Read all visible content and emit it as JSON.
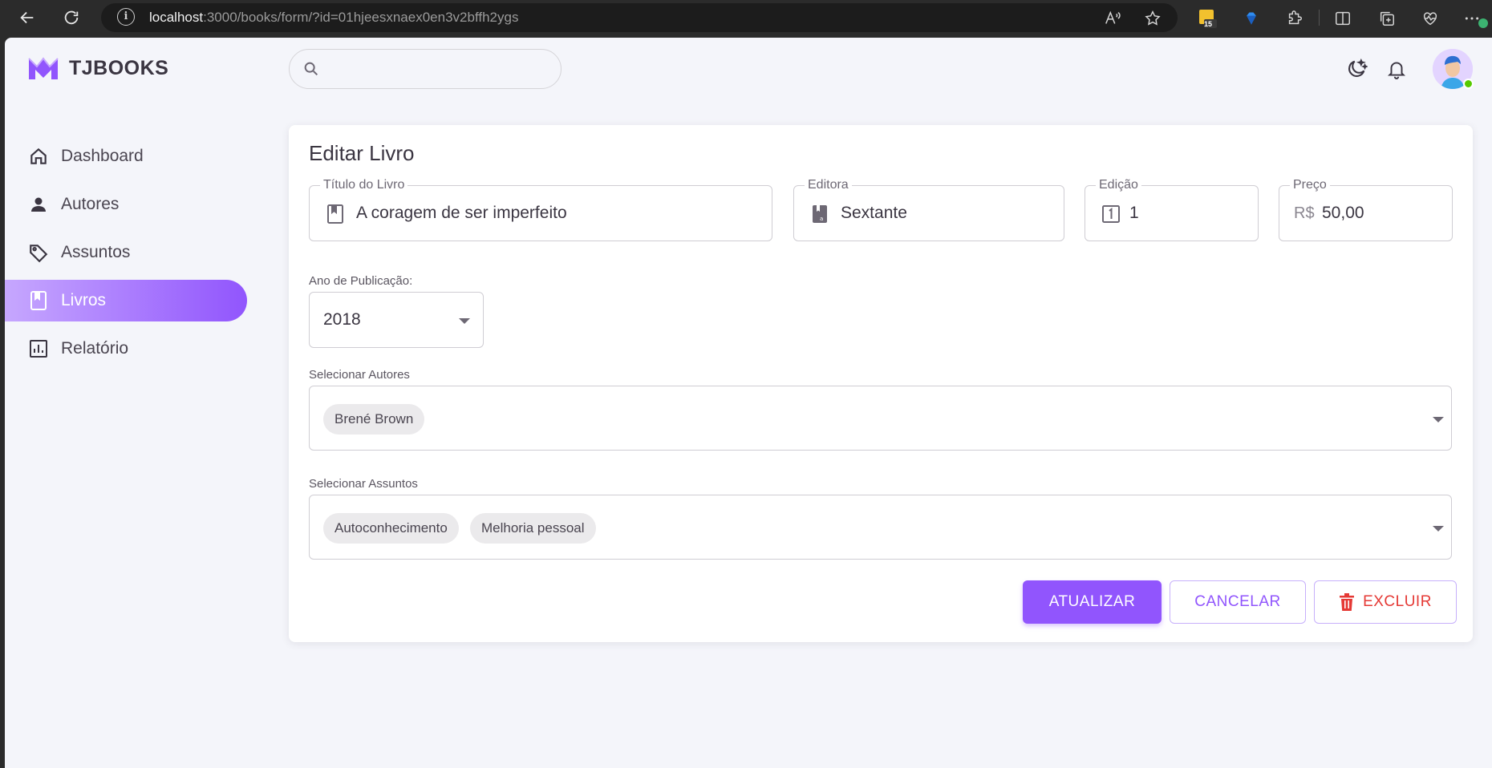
{
  "browser": {
    "url_host": "localhost",
    "url_rest": ":3000/books/form/?id=01hjeesxnaex0en3v2bffh2ygs",
    "extension_badge": "15"
  },
  "app": {
    "brand": "TJBOOKS",
    "search": {
      "placeholder": ""
    },
    "sidebar": {
      "items": [
        {
          "label": "Dashboard",
          "icon": "home-icon"
        },
        {
          "label": "Autores",
          "icon": "person-icon"
        },
        {
          "label": "Assuntos",
          "icon": "tag-icon"
        },
        {
          "label": "Livros",
          "icon": "book-icon",
          "active": true
        },
        {
          "label": "Relatório",
          "icon": "chart-icon"
        }
      ]
    },
    "colors": {
      "primary": "#9155fd",
      "danger": "#e53935",
      "background": "#f4f5fa"
    }
  },
  "form": {
    "title": "Editar Livro",
    "titulo": {
      "label": "Título do Livro",
      "value": "A coragem de ser imperfeito"
    },
    "editora": {
      "label": "Editora",
      "value": "Sextante"
    },
    "edicao": {
      "label": "Edição",
      "value": "1"
    },
    "preco": {
      "label": "Preço",
      "prefix": "R$",
      "value": "50,00"
    },
    "ano": {
      "label": "Ano de Publicação:",
      "value": "2018"
    },
    "autores": {
      "label": "Selecionar Autores",
      "chips": [
        "Brené Brown"
      ]
    },
    "assuntos": {
      "label": "Selecionar Assuntos",
      "chips": [
        "Autoconhecimento",
        "Melhoria pessoal"
      ]
    },
    "buttons": {
      "update": "ATUALIZAR",
      "cancel": "CANCELAR",
      "delete": "EXCLUIR"
    }
  }
}
